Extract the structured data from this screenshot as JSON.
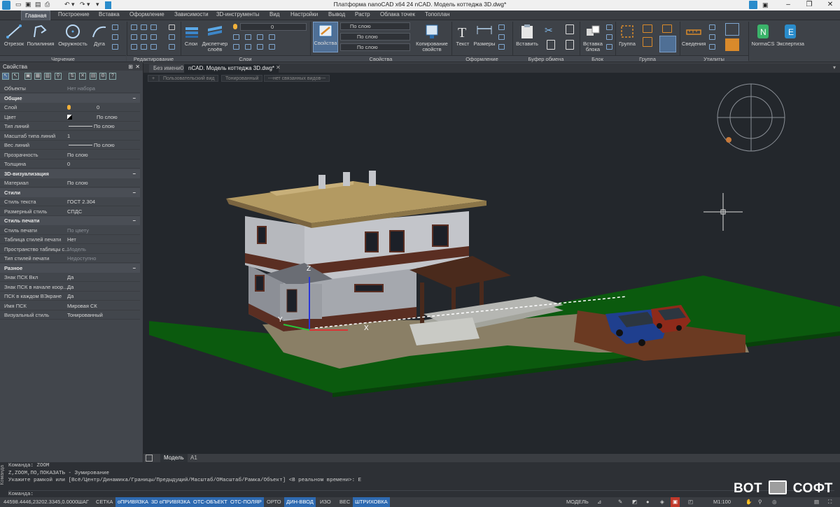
{
  "window": {
    "title": "Платформа nanoCAD x64 24 nCAD. Модель коттеджа 3D.dwg*",
    "minimize": "–",
    "maximize": "❐",
    "close": "✕"
  },
  "menu": {
    "tabs": [
      "Главная",
      "Построение",
      "Вставка",
      "Оформление",
      "Зависимости",
      "3D-инструменты",
      "Вид",
      "Настройки",
      "Вывод",
      "Растр",
      "Облака точек",
      "Топоплан"
    ],
    "active": 0
  },
  "ribbon": {
    "drawing": {
      "buttons": [
        "Отрезок",
        "Полилиния",
        "Окружность",
        "Дуга"
      ],
      "group": "Черчение"
    },
    "edit_group": "Редактирование",
    "layers": {
      "buttons": [
        "Слои",
        "Диспетчер слоёв"
      ],
      "group": "Слои",
      "layer_value": "0"
    },
    "properties": {
      "button": "Свойства",
      "combos": [
        "По слою",
        "По слою",
        "По слою"
      ],
      "copy_button": "Копирование свойств",
      "group": "Свойства"
    },
    "annotation": {
      "buttons": [
        "Текст",
        "Размеры"
      ],
      "group": "Оформление"
    },
    "clipboard": {
      "buttons": [
        "Вставить"
      ],
      "group": "Буфер обмена"
    },
    "block": {
      "buttons": [
        "Вставка блока"
      ],
      "group": "Блок"
    },
    "group": {
      "buttons": [
        "Группа"
      ],
      "group": "Группа"
    },
    "utilities": {
      "buttons": [
        "Сведения"
      ],
      "group": "Утилиты"
    },
    "extras": {
      "buttons": [
        "NormaCS",
        "Экспертиза"
      ]
    }
  },
  "properties_panel": {
    "title": "Свойства",
    "objects_key": "Объекты",
    "objects_value": "Нет набора",
    "sections": [
      {
        "title": "Общие",
        "rows": [
          {
            "k": "Слой",
            "v": "0"
          },
          {
            "k": "Цвет",
            "v": "По слою"
          },
          {
            "k": "Тип линий",
            "v": "По слою"
          },
          {
            "k": "Масштаб типа линий",
            "v": "1"
          },
          {
            "k": "Вес линий",
            "v": "По слою"
          },
          {
            "k": "Прозрачность",
            "v": "По слою"
          },
          {
            "k": "Толщина",
            "v": "0"
          }
        ]
      },
      {
        "title": "3D-визуализация",
        "rows": [
          {
            "k": "Материал",
            "v": "По слою"
          }
        ]
      },
      {
        "title": "Стили",
        "rows": [
          {
            "k": "Стиль текста",
            "v": "ГОСТ 2.304"
          },
          {
            "k": "Размерный стиль",
            "v": "СПДС"
          }
        ]
      },
      {
        "title": "Стиль печати",
        "rows": [
          {
            "k": "Стиль печати",
            "v": "По цвету"
          },
          {
            "k": "Таблица стилей печати",
            "v": "Нет"
          },
          {
            "k": "Пространство таблицы с...",
            "v": "Модель"
          },
          {
            "k": "Тип стилей печати",
            "v": "Недоступно"
          }
        ]
      },
      {
        "title": "Разное",
        "rows": [
          {
            "k": "Знак ПСК Вкл",
            "v": "Да"
          },
          {
            "k": "Знак ПСК в начале коор...",
            "v": "Да"
          },
          {
            "k": "ПСК в каждом ВЭкране",
            "v": "Да"
          },
          {
            "k": "Имя ПСК",
            "v": "Мировая СК"
          },
          {
            "k": "Визуальный стиль",
            "v": "Тонированный"
          }
        ]
      }
    ]
  },
  "doc_tabs": [
    "Без имени0",
    "nCAD. Модель коттеджа 3D.dwg*"
  ],
  "view_tags": [
    "+",
    "Пользовательский вид",
    "Тонированный",
    "---нет связанных видов---"
  ],
  "model_tabs": [
    "Модель",
    "A1"
  ],
  "ucs": {
    "x": "X",
    "y": "Y",
    "z": "Z"
  },
  "command_lines": [
    "Команда: ZOOM",
    "Z,ZOOM,ПО,ПОКАЗАТЬ - Зумирование",
    "Укажите рамкой или [Всё/Центр/Динамика/Границы/Предыдущий/Масштаб/ОМасштаб/Рамка/Объект] <В реальном времени>: E",
    "",
    "Команда:"
  ],
  "command_side_label": "Команда",
  "status": {
    "coords": "44598.4446,23202.3345,0.0000",
    "toggles": [
      {
        "label": "ШАГ",
        "on": false
      },
      {
        "label": "СЕТКА",
        "on": false
      },
      {
        "label": "оПРИВЯЗКА",
        "on": true
      },
      {
        "label": "3D оПРИВЯЗКА",
        "on": true
      },
      {
        "label": "ОТС-ОБЪЕКТ",
        "on": true
      },
      {
        "label": "ОТС-ПОЛЯР",
        "on": true
      },
      {
        "label": "ОРТО",
        "on": false
      },
      {
        "label": "ДИН-ВВОД",
        "on": true
      },
      {
        "label": "ИЗО",
        "on": false
      },
      {
        "label": "ВЕС",
        "on": false
      },
      {
        "label": "ШТРИХОВКА",
        "on": true
      }
    ],
    "space": "МОДЕЛЬ",
    "scale": "М1:100"
  },
  "watermark": {
    "left": "ВОТ",
    "right": "СОФТ"
  },
  "colors": {
    "accent": "#2e6ab1",
    "ground": "#0b5a0e",
    "roof": "#b39a62",
    "brick": "#5a2e22",
    "wall": "#9c9fa6"
  }
}
